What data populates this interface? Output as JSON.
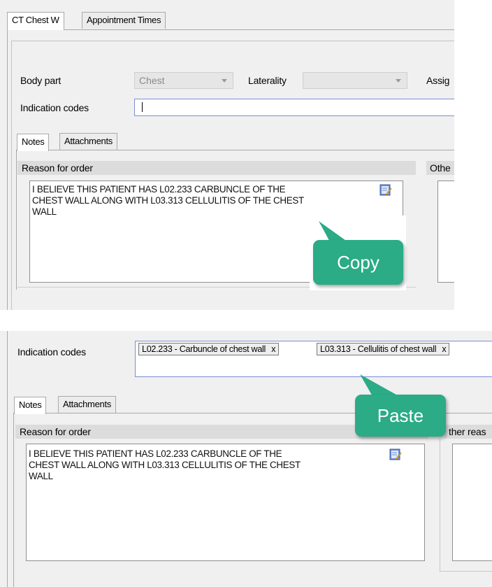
{
  "top": {
    "tabs": [
      {
        "label": "CT Chest W",
        "active": true
      },
      {
        "label": "Appointment Times",
        "active": false
      }
    ],
    "fields": {
      "body_part_label": "Body part",
      "body_part_value": "Chest",
      "laterality_label": "Laterality",
      "laterality_value": "",
      "assign_label": "Assig",
      "indication_codes_label": "Indication codes"
    },
    "inner_tabs": [
      {
        "label": "Notes",
        "active": true
      },
      {
        "label": "Attachments",
        "active": false
      }
    ],
    "reason_header": "Reason for order",
    "other_header": "Othe",
    "reason_lines": [
      "I BELIEVE THIS PATIENT HAS L02.233 CARBUNCLE OF THE",
      "CHEST WALL ALONG WITH L03.313 CELLULITIS OF THE CHEST",
      "WALL"
    ],
    "callout": "Copy"
  },
  "bottom": {
    "indication_codes_label": "Indication codes",
    "chips": [
      {
        "text": "L02.233 - Carbuncle of chest wall",
        "remove": "x"
      },
      {
        "text": "L03.313 - Cellulitis of chest wall",
        "remove": "x"
      }
    ],
    "inner_tabs": [
      {
        "label": "Notes",
        "active": true
      },
      {
        "label": "Attachments",
        "active": false
      }
    ],
    "reason_header": "Reason for order",
    "other_header": "ther reas",
    "reason_lines": [
      "I BELIEVE THIS PATIENT HAS L02.233 CARBUNCLE OF THE",
      "CHEST WALL ALONG WITH L03.313 CELLULITIS OF THE CHEST",
      "WALL"
    ],
    "callout": "Paste"
  },
  "colors": {
    "callout": "#2bab86",
    "field_border": "#7a8ed6",
    "panel": "#f0f0f0"
  },
  "icons": [
    "edit-note-icon",
    "dropdown-arrow-icon"
  ]
}
